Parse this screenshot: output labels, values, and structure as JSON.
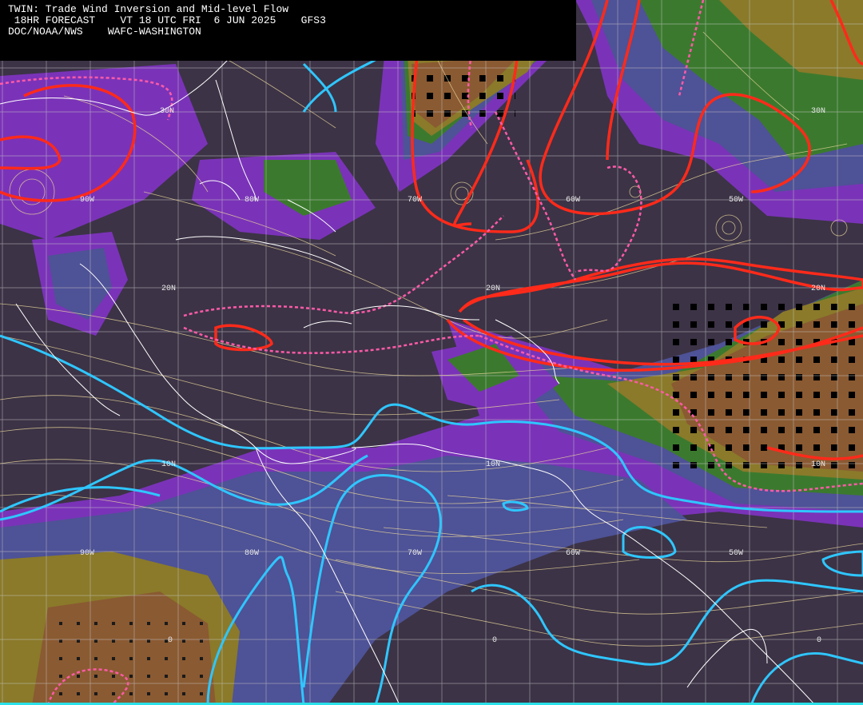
{
  "header": {
    "line1": "TWIN: Trade Wind Inversion and Mid-level Flow",
    "line2": " 18HR FORECAST    VT 18 UTC FRI  6 JUN 2025    GFS3",
    "line3": "DOC/NOAA/NWS    WAFC-WASHINGTON"
  },
  "lat_labels": [
    "30N",
    "30N",
    "20N",
    "20N",
    "20N",
    "10N",
    "10N",
    "10N",
    "0",
    "0",
    "0"
  ],
  "lon_labels": [
    "90W",
    "80W",
    "70W",
    "60W",
    "50W",
    "90W",
    "80W",
    "70W",
    "60W",
    "50W"
  ],
  "colors": {
    "background": "#3c3346",
    "blue_band": "#4e5296",
    "purple_band": "#7a33b8",
    "green_band": "#3b7a2e",
    "olive_band": "#8a7a2a",
    "brown_band": "#8a5a32",
    "red_contour": "#ff2a1a",
    "cyan_contour": "#2fc6ff",
    "pink_dashed": "#ff5aa8",
    "streamline": "#e8d69a",
    "coastline": "#ffffff",
    "grid": "#c8c8c8"
  },
  "icons": [
    "streamline-arrows",
    "inversion-dots"
  ]
}
